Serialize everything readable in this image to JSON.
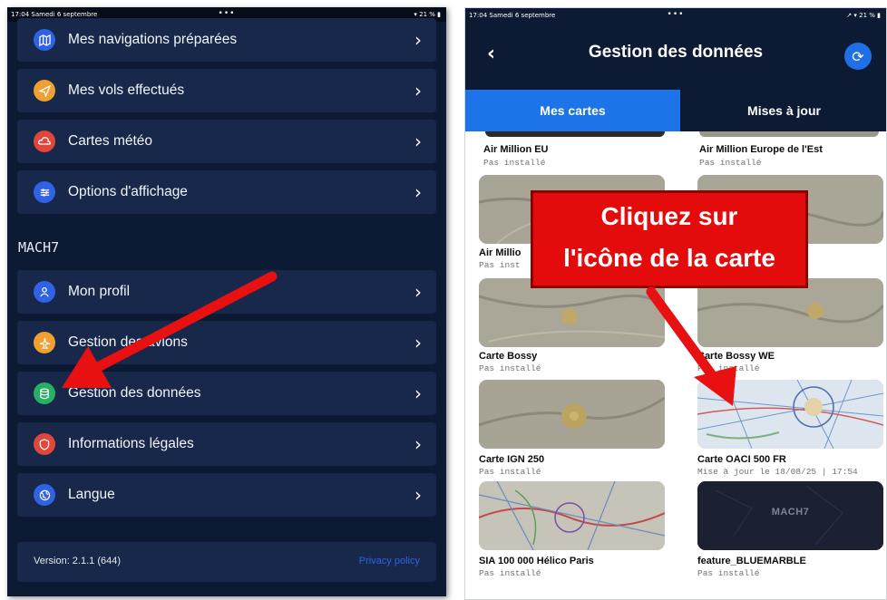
{
  "left_panel": {
    "status": {
      "time_date": "17:04  Samedi 6 septembre",
      "dots": "•••",
      "battery": "▾ 21 % ▮"
    },
    "menu_top": [
      {
        "label": "Mes navigations préparées",
        "icon": "map-icon",
        "icon_color": "#2f62e4"
      },
      {
        "label": "Mes vols effectués",
        "icon": "send-icon",
        "icon_color": "#f0a030"
      },
      {
        "label": "Cartes météo",
        "icon": "cloud-icon",
        "icon_color": "#e0473a"
      },
      {
        "label": "Options d'affichage",
        "icon": "sliders-icon",
        "icon_color": "#2f62e4"
      }
    ],
    "section_title": "MACH7",
    "menu_mach7": [
      {
        "label": "Mon profil",
        "icon": "user-icon",
        "icon_color": "#2f62e4"
      },
      {
        "label": "Gestion des avions",
        "icon": "plane-icon",
        "icon_color": "#f0a030"
      },
      {
        "label": "Gestion des données",
        "icon": "database-icon",
        "icon_color": "#27b064"
      },
      {
        "label": "Informations légales",
        "icon": "shield-icon",
        "icon_color": "#e0473a"
      },
      {
        "label": "Langue",
        "icon": "globe-icon",
        "icon_color": "#2f62e4"
      }
    ],
    "chevron": "›",
    "version": "Version: 2.1.1 (644)",
    "privacy": "Privacy policy"
  },
  "right_panel": {
    "status": {
      "time_date": "17:04  Samedi 6 septembre",
      "dots": "•••",
      "battery": "↗ ▾ 21 % ▮"
    },
    "back": "‹",
    "title": "Gestion des données",
    "sync_icon": "⟳",
    "tabs": [
      {
        "label": "Mes cartes"
      },
      {
        "label": "Mises à jour"
      }
    ],
    "cards": [
      {
        "name": "Air Million EU",
        "status": "Pas installé",
        "thumb": "none"
      },
      {
        "name": "Air Million Europe de l'Est",
        "status": "Pas installé",
        "thumb": "none"
      },
      {
        "name": "Air Millio",
        "status": "Pas inst",
        "thumb": "terrain"
      },
      {
        "name": "",
        "status": "",
        "thumb": "terrain"
      },
      {
        "name": "Carte Bossy",
        "status": "Pas installé",
        "thumb": "terrain"
      },
      {
        "name": "Carte Bossy WE",
        "status": "Pas installé",
        "thumb": "terrain"
      },
      {
        "name": "Carte IGN 250",
        "status": "Pas installé",
        "thumb": "terrain"
      },
      {
        "name": "Carte OACI 500 FR",
        "status": "Mise à jour le 18/08/25 | 17:54",
        "thumb": "oaci"
      },
      {
        "name": "SIA 100 000 Hélico Paris",
        "status": "Pas installé",
        "thumb": "sia"
      },
      {
        "name": "feature_BLUEMARBLE",
        "status": "Pas installé",
        "thumb": "dark",
        "logo": "MACH7"
      }
    ]
  },
  "callout": {
    "line1": "Cliquez sur",
    "line2": "l'icône de la carte"
  },
  "colors": {
    "dark_bg": "#0c1a33",
    "item_bg": "#17284a",
    "accent": "#1d74e8",
    "annotation_red": "#e30b0b"
  }
}
